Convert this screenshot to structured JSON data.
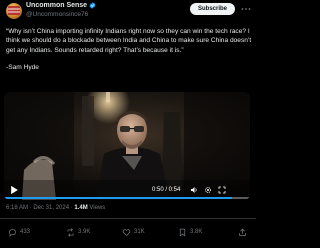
{
  "author": {
    "display_name": "Uncommon Sense",
    "handle": "@Uncommonsince76",
    "verified": true,
    "accent": "#1d9bf0"
  },
  "header": {
    "subscribe_label": "Subscribe",
    "more_icon": "more-icon"
  },
  "tweet": {
    "text": "“Why isn’t China importing infinity Indians right now so they can win the tech race? I think we should do a blockade between India and China to make sure China doesn’t get any Indians. Sounds retarded right? That’s because it is.”",
    "attribution": "-Sam Hyde"
  },
  "video": {
    "time": "0:50 / 0:54",
    "progress_fraction": 0.926,
    "play_icon": "play-icon",
    "volume_icon": "volume-icon",
    "settings_icon": "settings-icon",
    "fullscreen_icon": "fullscreen-icon"
  },
  "meta": {
    "timestamp": "6:18 AM · Dec 31, 2024 · ",
    "views_count": "1.4M",
    "views_label": " Views"
  },
  "actions": {
    "replies": "433",
    "reposts": "3.9K",
    "likes": "31K",
    "bookmarks": "3.8K"
  },
  "colors": {
    "background": "#000000",
    "text": "#e7e9ea",
    "muted": "#71767b",
    "accent": "#1d9bf0",
    "divider": "#2f3336"
  }
}
